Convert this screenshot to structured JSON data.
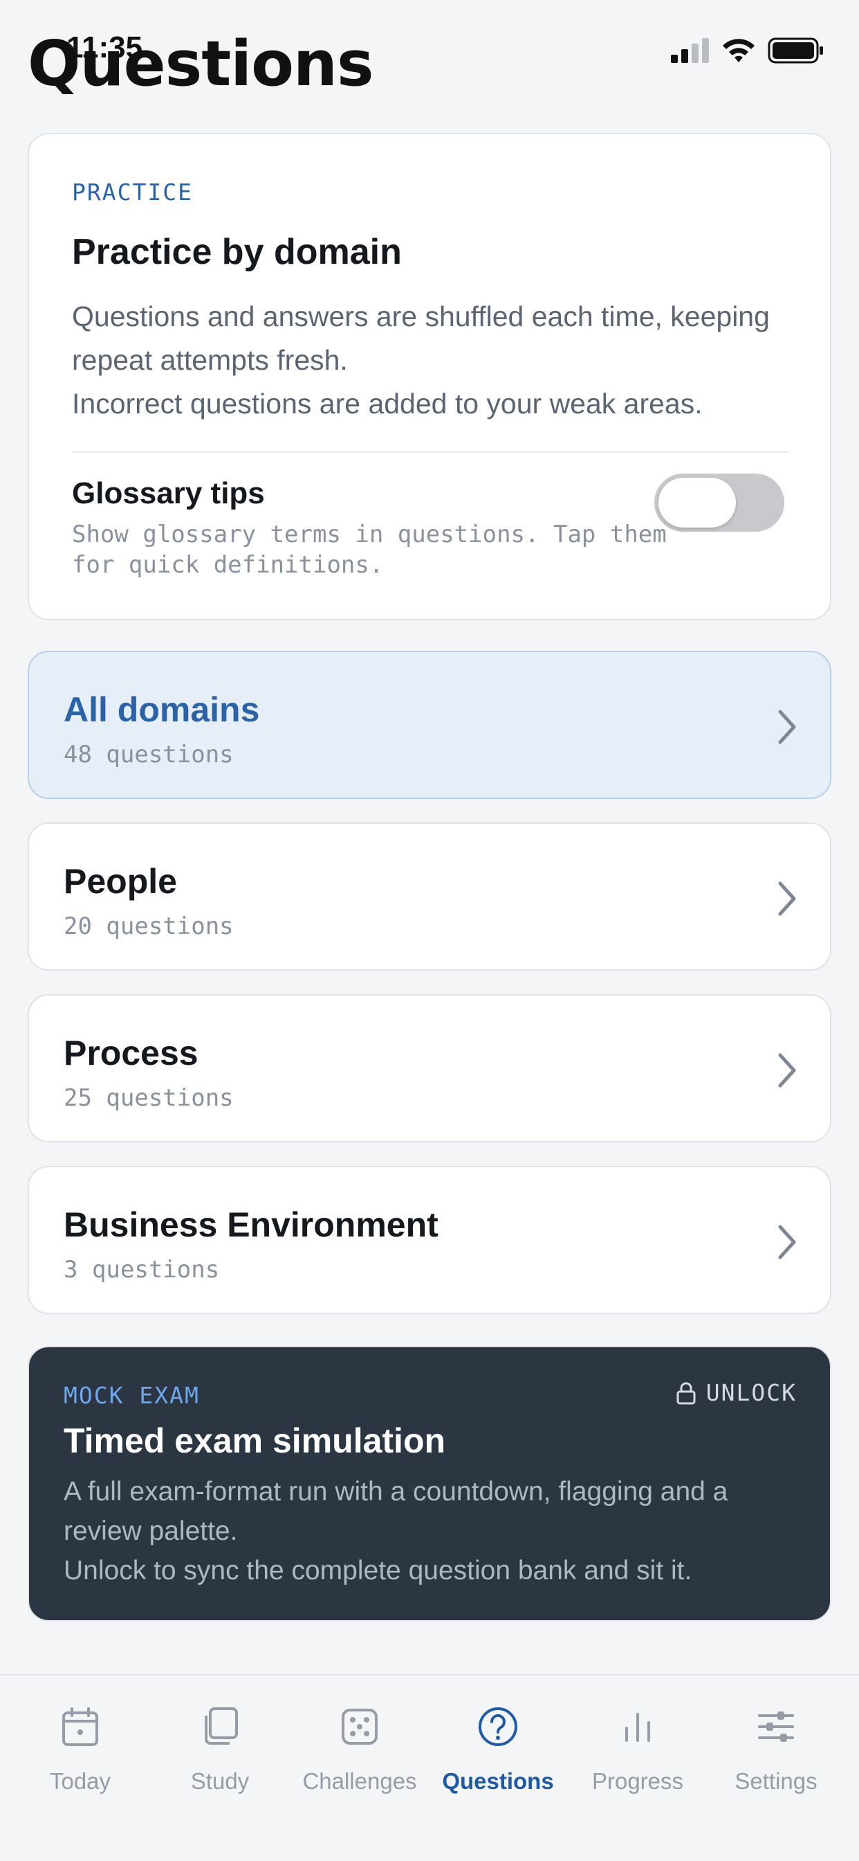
{
  "status": {
    "time": "11:35"
  },
  "header": {
    "title": "Questions"
  },
  "practice": {
    "eyebrow": "PRACTICE",
    "title": "Practice by domain",
    "desc_line1": "Questions and answers are shuffled each time, keeping repeat attempts fresh.",
    "desc_line2": "Incorrect questions are added to your weak areas.",
    "glossary_title": "Glossary tips",
    "glossary_desc": "Show glossary terms in questions. Tap them for quick definitions.",
    "glossary_enabled": false
  },
  "domains": [
    {
      "name": "All domains",
      "count": "48 questions",
      "active": true
    },
    {
      "name": "People",
      "count": "20 questions",
      "active": false
    },
    {
      "name": "Process",
      "count": "25 questions",
      "active": false
    },
    {
      "name": "Business Environment",
      "count": "3 questions",
      "active": false
    }
  ],
  "mock": {
    "eyebrow": "MOCK EXAM",
    "unlock_label": "UNLOCK",
    "title": "Timed exam simulation",
    "desc_line1": "A full exam-format run with a countdown, flagging and a review palette.",
    "desc_line2": "Unlock to sync the complete question bank and sit it."
  },
  "tabs": [
    {
      "label": "Today",
      "icon": "calendar-icon"
    },
    {
      "label": "Study",
      "icon": "cards-icon"
    },
    {
      "label": "Challenges",
      "icon": "dice-icon"
    },
    {
      "label": "Questions",
      "icon": "question-circle-icon",
      "active": true
    },
    {
      "label": "Progress",
      "icon": "bar-chart-icon"
    },
    {
      "label": "Settings",
      "icon": "sliders-icon"
    }
  ],
  "colors": {
    "accent": "#2a63a8",
    "tab_active": "#1f5aa5",
    "mock_bg": "#2b3642",
    "active_row_bg": "#e6eef8"
  }
}
